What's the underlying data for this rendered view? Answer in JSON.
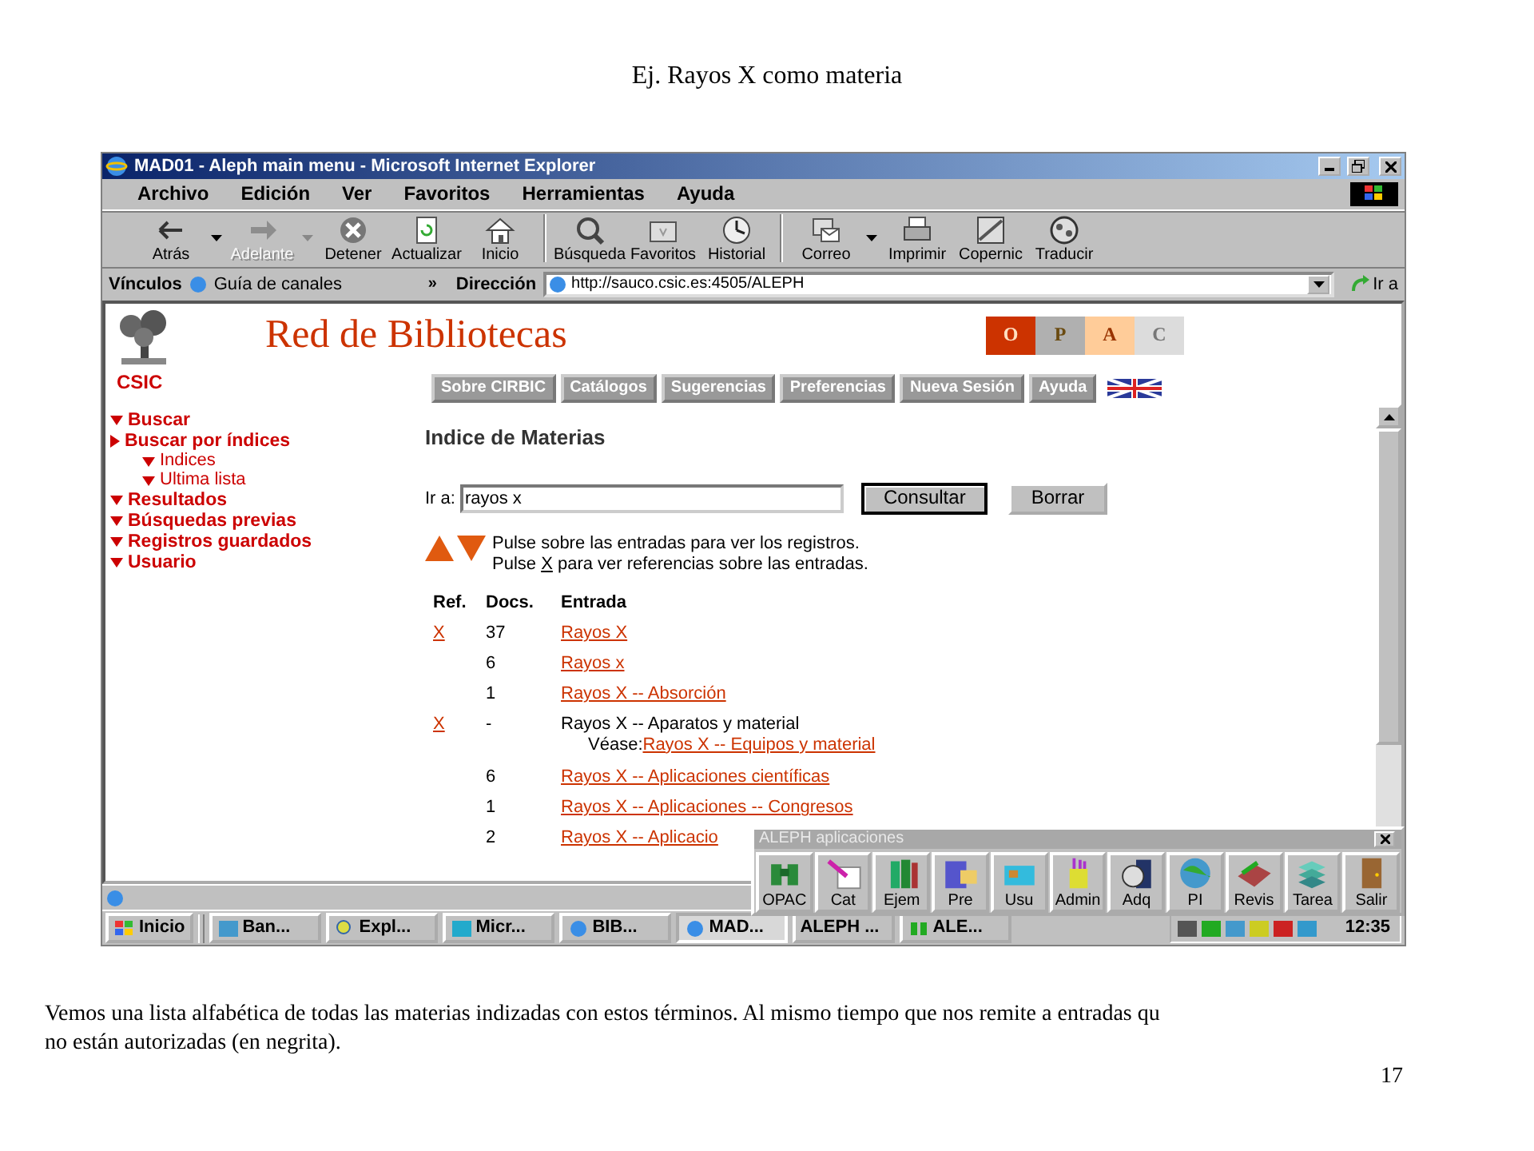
{
  "slide": {
    "title": "Ej. Rayos X como materia",
    "caption_lines": [
      "Vemos una lista alfabética de todas las materias indizadas con estos términos. Al mismo tiempo que nos remite a entradas qu",
      "no están autorizadas (en negrita)."
    ],
    "page_number": "17"
  },
  "window": {
    "title": "MAD01 - Aleph main menu - Microsoft Internet Explorer"
  },
  "menu": [
    "Archivo",
    "Edición",
    "Ver",
    "Favoritos",
    "Herramientas",
    "Ayuda"
  ],
  "toolbar": [
    {
      "label": "Atrás",
      "disabled": false,
      "dropdown": true
    },
    {
      "label": "Adelante",
      "disabled": true,
      "dropdown": true
    },
    {
      "label": "Detener",
      "disabled": false,
      "dropdown": false
    },
    {
      "label": "Actualizar",
      "disabled": false,
      "dropdown": false
    },
    {
      "label": "Inicio",
      "disabled": false,
      "dropdown": false
    },
    {
      "label": "Búsqueda",
      "disabled": false,
      "dropdown": false
    },
    {
      "label": "Favoritos",
      "disabled": false,
      "dropdown": false
    },
    {
      "label": "Historial",
      "disabled": false,
      "dropdown": false
    },
    {
      "label": "Correo",
      "disabled": false,
      "dropdown": true
    },
    {
      "label": "Imprimir",
      "disabled": false,
      "dropdown": false
    },
    {
      "label": "Copernic",
      "disabled": false,
      "dropdown": false
    },
    {
      "label": "Traducir",
      "disabled": false,
      "dropdown": false
    }
  ],
  "address_bar": {
    "links_label": "Vínculos",
    "link": "Guía de canales",
    "more": "»",
    "address_label": "Dirección",
    "url": "http://sauco.csic.es:4505/ALEPH",
    "go": "Ir a"
  },
  "page": {
    "site_title": "Red de Bibliotecas",
    "logo_label": "CSIC",
    "opac_tiles": [
      {
        "letter": "O",
        "color": "#cc3300"
      },
      {
        "letter": "P",
        "color": "#b0b0b0"
      },
      {
        "letter": "A",
        "color": "#ffcc99"
      },
      {
        "letter": "C",
        "color": "#dcdcdc"
      }
    ],
    "nav": [
      "Sobre CIRBIC",
      "Catálogos",
      "Sugerencias",
      "Preferencias",
      "Nueva Sesión",
      "Ayuda"
    ],
    "sidebar": [
      {
        "label": "Buscar",
        "selected": false
      },
      {
        "label": "Buscar por índices",
        "selected": true,
        "children": [
          {
            "label": "Indices",
            "selected": false
          },
          {
            "label": "Ultima lista",
            "selected": false
          }
        ]
      },
      {
        "label": "Resultados",
        "selected": false
      },
      {
        "label": "Búsquedas previas",
        "selected": false
      },
      {
        "label": "Registros guardados",
        "selected": false
      },
      {
        "label": "Usuario",
        "selected": false
      }
    ],
    "heading": "Indice de Materias",
    "search": {
      "label": "Ir a:",
      "value": "rayos x",
      "buttons": [
        "Consultar",
        "Borrar"
      ]
    },
    "instructions": {
      "line_1": "Pulse sobre las entradas para ver los registros.",
      "line_2_before": "Pulse",
      "line_2_ref": "X",
      "line_2_after": "para ver referencias sobre las entradas."
    },
    "table": {
      "columns": [
        "Ref.",
        "Docs.",
        "Entrada"
      ],
      "rows": [
        {
          "ref": "X",
          "docs": "37",
          "entry": "Rayos X",
          "linked": true
        },
        {
          "docs": "6",
          "entry": "Rayos x",
          "linked": true
        },
        {
          "docs": "1",
          "entry": "Rayos X -- Absorción",
          "linked": true
        },
        {
          "ref": "X",
          "docs": "-",
          "entry": "Rayos X -- Aparatos y material",
          "linked": false,
          "see_label": "Véase:",
          "see_target": "Rayos X -- Equipos y material"
        },
        {
          "docs": "6",
          "entry": "Rayos X -- Aplicaciones científicas",
          "linked": true
        },
        {
          "docs": "1",
          "entry": "Rayos X -- Aplicaciones -- Congresos",
          "linked": true
        },
        {
          "docs": "2",
          "entry": "Rayos X -- Aplicacio",
          "linked": true
        }
      ]
    }
  },
  "palette": {
    "title": "ALEPH aplicaciones",
    "buttons": [
      "OPAC",
      "Cat",
      "Ejem",
      "Pre",
      "Usu",
      "Admin",
      "Adq",
      "PI",
      "Revis",
      "Tarea",
      "Salir"
    ]
  },
  "taskbar": {
    "start": "Inicio",
    "tasks": [
      {
        "label": "Ban...",
        "selected": false
      },
      {
        "label": "Expl...",
        "selected": false
      },
      {
        "label": "Micr...",
        "selected": false
      },
      {
        "label": "BIB...",
        "selected": false
      },
      {
        "label": "MAD...",
        "selected": true
      },
      {
        "label": "ALEPH ...",
        "selected": false
      },
      {
        "label": "ALE...",
        "selected": false
      }
    ],
    "clock": "12:35"
  }
}
